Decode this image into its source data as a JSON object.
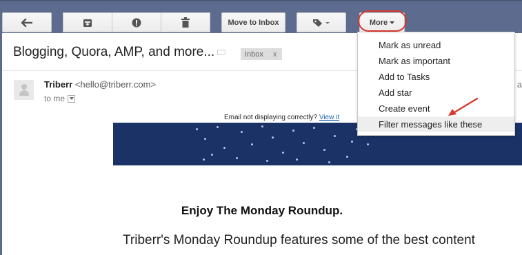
{
  "toolbar": {
    "back_icon": "back-arrow-icon",
    "archive_icon": "archive-icon",
    "spam_icon": "report-spam-icon",
    "delete_icon": "trash-icon",
    "move_to_inbox_label": "Move to Inbox",
    "labels_icon": "tag-icon",
    "more_label": "More"
  },
  "message": {
    "subject": "Blogging, Quora, AMP, and more...",
    "label_chip": "Inbox",
    "label_chip_close": "x",
    "sender_name": "Triberr",
    "sender_email": "<hello@triberr.com>",
    "to_line": "to me",
    "right_partial": "y a",
    "not_displaying": "Email not displaying correctly?",
    "view_link": "View it",
    "headline": "Enjoy The Monday Roundup.",
    "body_line": "Triberr's Monday Roundup features some of the best content"
  },
  "more_menu": {
    "items": [
      "Mark as unread",
      "Mark as important",
      "Add to Tasks",
      "Add star",
      "Create event",
      "Filter messages like these"
    ],
    "highlighted_index": 5
  },
  "colors": {
    "toolbar_bg": "#5c6b8e",
    "banner_bg": "#1a3266",
    "annotation_red": "#d9372f"
  }
}
